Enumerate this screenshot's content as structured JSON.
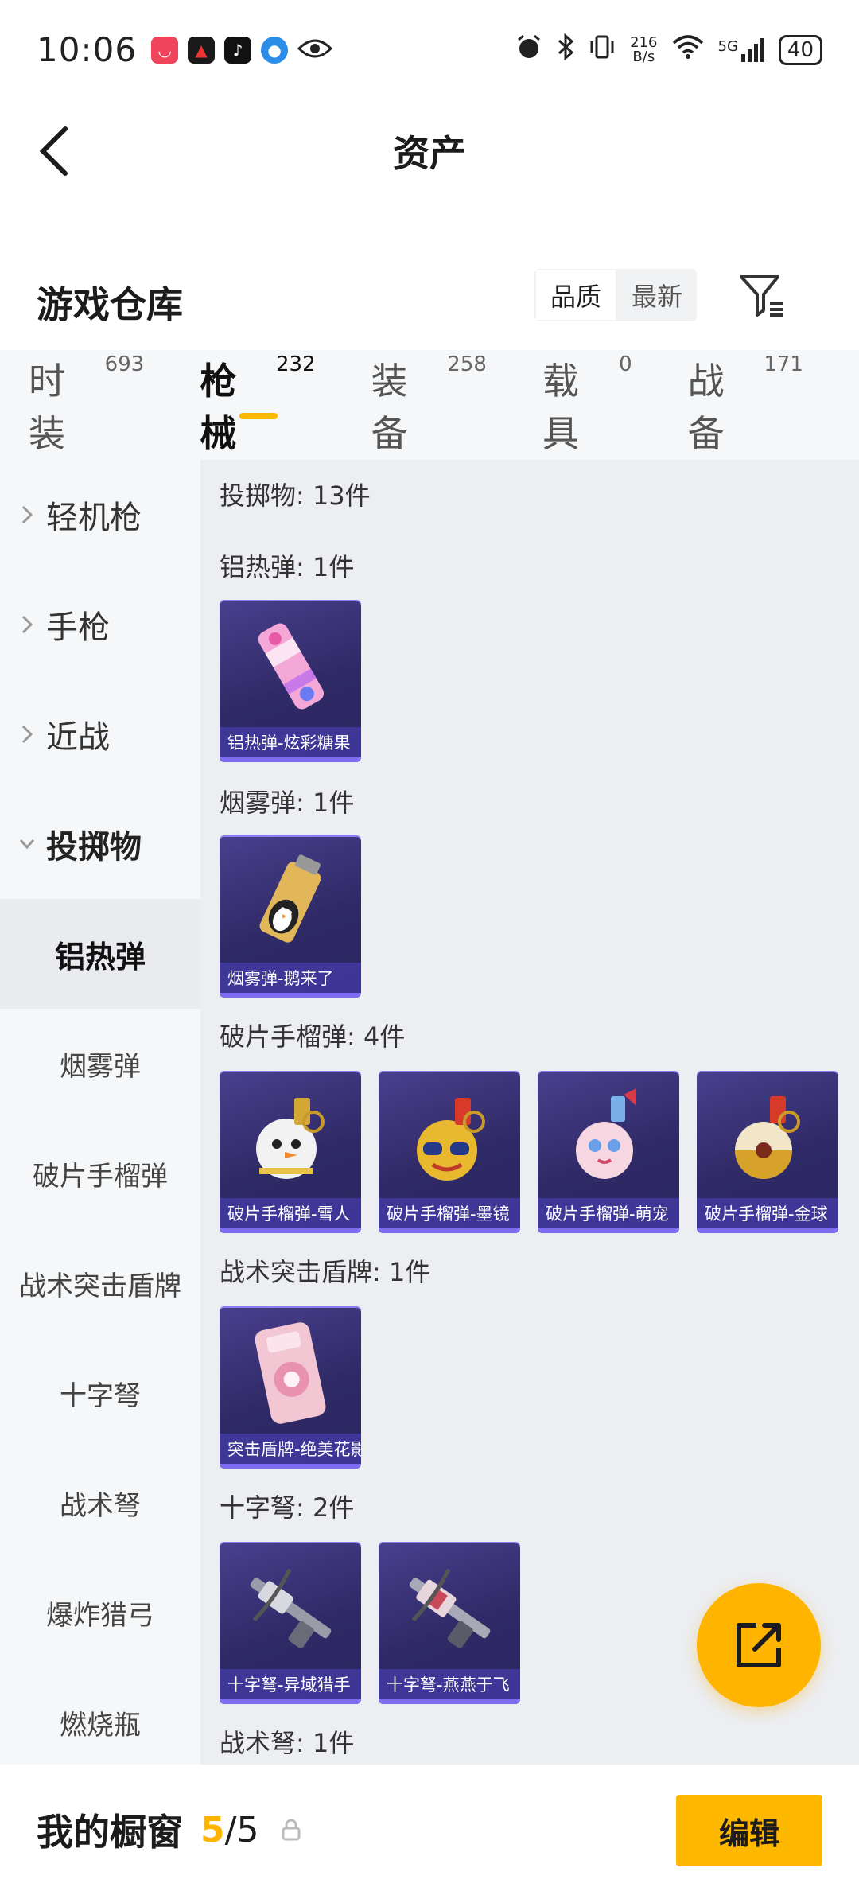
{
  "status_bar": {
    "time": "10:06",
    "net_speed_value": "216",
    "net_speed_unit": "B/s",
    "network": "5G",
    "battery": "40"
  },
  "header": {
    "title": "资产"
  },
  "section": {
    "title": "游戏仓库",
    "sort_options": [
      "品质",
      "最新"
    ]
  },
  "tabs": [
    {
      "label": "时装",
      "count": "693"
    },
    {
      "label": "枪械",
      "count": "232"
    },
    {
      "label": "装备",
      "count": "258"
    },
    {
      "label": "载具",
      "count": "0"
    },
    {
      "label": "战备",
      "count": "171"
    }
  ],
  "sidebar": {
    "categories": [
      {
        "label": "轻机枪"
      },
      {
        "label": "手枪"
      },
      {
        "label": "近战"
      },
      {
        "label": "投掷物"
      }
    ],
    "subcategories": [
      {
        "label": "铝热弹"
      },
      {
        "label": "烟雾弹"
      },
      {
        "label": "破片手榴弹"
      },
      {
        "label": "战术突击盾牌"
      },
      {
        "label": "十字弩"
      },
      {
        "label": "战术弩"
      },
      {
        "label": "爆炸猎弓"
      },
      {
        "label": "燃烧瓶"
      }
    ]
  },
  "content": {
    "summary": "投掷物: 13件",
    "groups": [
      {
        "title": "铝热弹: 1件",
        "items": [
          "铝热弹-炫彩糖果"
        ]
      },
      {
        "title": "烟雾弹: 1件",
        "items": [
          "烟雾弹-鹅来了"
        ]
      },
      {
        "title": "破片手榴弹: 4件",
        "items": [
          "破片手榴弹-雪人",
          "破片手榴弹-墨镜",
          "破片手榴弹-萌宠",
          "破片手榴弹-金球"
        ]
      },
      {
        "title": "战术突击盾牌: 1件",
        "items": [
          "突击盾牌-绝美花影"
        ]
      },
      {
        "title": "十字弩: 2件",
        "items": [
          "十字弩-异域猎手",
          "十字弩-燕燕于飞"
        ]
      },
      {
        "title": "战术弩: 1件",
        "items": []
      }
    ]
  },
  "bottom_bar": {
    "label": "我的橱窗",
    "current": "5",
    "separator": "/",
    "total": "5",
    "edit_label": "编辑"
  },
  "colors": {
    "accent": "#ffb800",
    "card_bg": "#2f2a66",
    "sidebar_bg": "#f6f7f9",
    "content_bg": "#eceef2"
  }
}
